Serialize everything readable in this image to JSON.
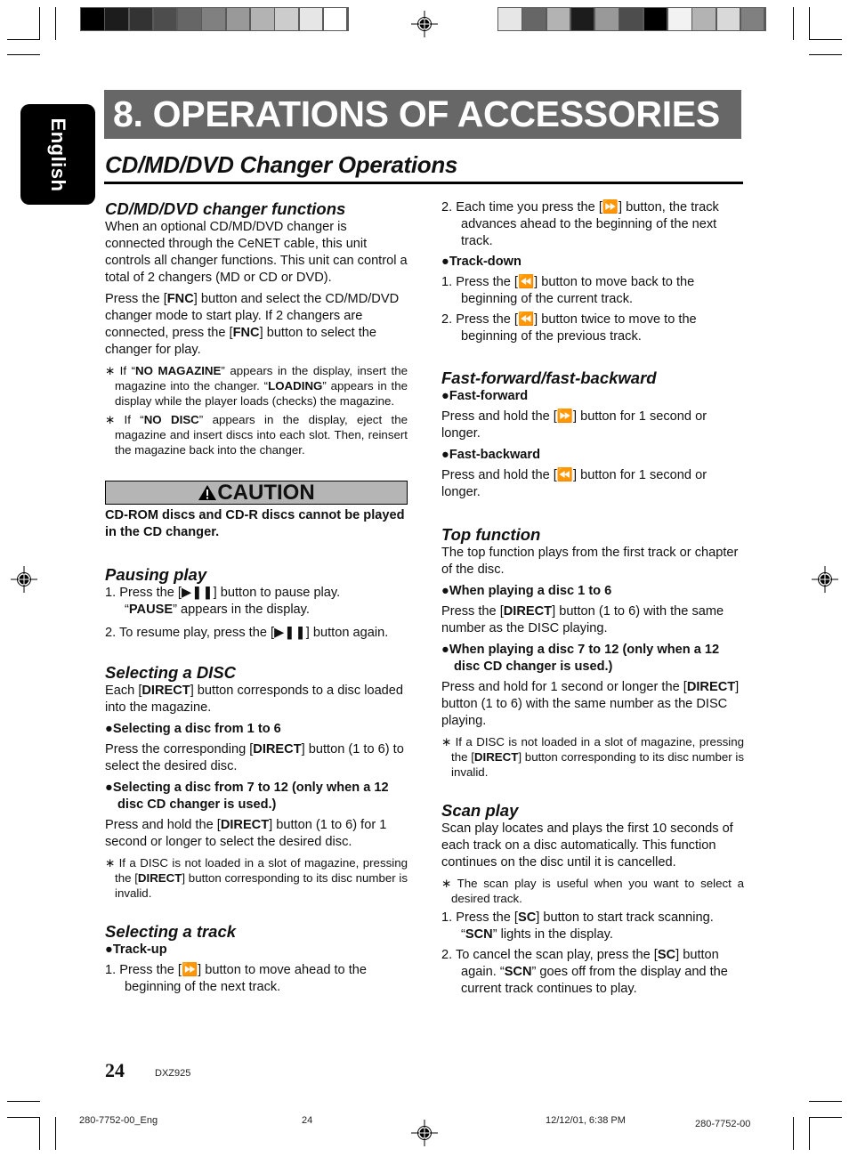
{
  "language_tab": "English",
  "chapter_title": "8. OPERATIONS OF ACCESSORIES",
  "section_title": "CD/MD/DVD Changer Operations",
  "colors": {
    "banner_bg": "#676767",
    "caution_bg": "#b5b5b5",
    "swatches_left": [
      "#000000",
      "#1c1c1c",
      "#333333",
      "#4d4d4d",
      "#666666",
      "#808080",
      "#999999",
      "#b3b3b3",
      "#cccccc",
      "#e6e6e6",
      "#ffffff"
    ],
    "swatches_right": [
      "#e6e6e6",
      "#666666",
      "#b3b3b3",
      "#1c1c1c",
      "#999999",
      "#4d4d4d",
      "#000000",
      "#f2f2f2",
      "#b3b3b3",
      "#d9d9d9",
      "#808080"
    ]
  },
  "left": {
    "changer_functions": {
      "heading": "CD/MD/DVD changer functions",
      "p1": "When an optional CD/MD/DVD changer is connected through the CeNET cable, this unit controls all changer functions. This unit can control a total of 2 changers (MD or CD or DVD).",
      "p2_a": "Press the [",
      "p2_b1": "FNC",
      "p2_c": "] button and select the CD/MD/DVD changer mode to start play. If 2 changers are connected, press the [",
      "p2_b2": "FNC",
      "p2_d": "] button to select the changer for play.",
      "note1_a": "∗ If “",
      "note1_b": "NO MAGAZINE",
      "note1_c": "” appears in the display, insert the magazine into the changer. “",
      "note1_d": "LOADING",
      "note1_e": "” appears in the display while the player loads (checks) the magazine.",
      "note2_a": "∗ If “",
      "note2_b": "NO DISC",
      "note2_c": "” appears in the display, eject the magazine and insert discs into each slot. Then, reinsert the magazine back into the changer."
    },
    "caution": {
      "label": "CAUTION",
      "text": "CD-ROM discs and CD-R discs cannot be played in the CD changer."
    },
    "pausing": {
      "heading": "Pausing play",
      "step1_a": "1.  Press the [▶❚❚] button to pause play.",
      "step1_b": "PAUSE",
      "step1_c": "” appears in the display.",
      "step2": "2.  To resume play, press the [▶❚❚] button again."
    },
    "selecting_disc": {
      "heading": "Selecting a DISC",
      "p1_a": "Each [",
      "p1_b": "DIRECT",
      "p1_c": "] button corresponds to a disc loaded into the magazine.",
      "bullet1": "●Selecting a disc from 1 to 6",
      "p2_a": "Press the corresponding [",
      "p2_b": "DIRECT",
      "p2_c": "] button (1 to 6) to select the desired disc.",
      "bullet2": "●Selecting a disc from 7 to 12 (only when a 12 disc CD changer is used.)",
      "p3_a": "Press and hold the [",
      "p3_b": "DIRECT",
      "p3_c": "] button (1 to 6) for 1 second or longer to select the desired disc.",
      "note_a": "∗ If a DISC is not loaded in a slot of magazine, pressing  the [",
      "note_b": "DIRECT",
      "note_c": "] button corresponding to its disc number is invalid."
    },
    "selecting_track": {
      "heading": "Selecting a track",
      "bullet": "●Track-up",
      "step1": "1.  Press the [⏩] button to move ahead to the beginning of the next track."
    }
  },
  "right": {
    "track_up_step2": "2.  Each time you press the [⏩] button, the track advances ahead to the beginning of the next track.",
    "track_down": {
      "bullet": "●Track-down",
      "step1": "1.  Press the [⏪] button to move back to the beginning of the current track.",
      "step2": "2.  Press the [⏪] button twice to move to the beginning of the previous track."
    },
    "fast": {
      "heading": "Fast-forward/fast-backward",
      "bullet1": "●Fast-forward",
      "p1": "Press and hold the [⏩] button for 1 second or longer.",
      "bullet2": "●Fast-backward",
      "p2": "Press and hold the [⏪] button for 1 second or longer."
    },
    "top": {
      "heading": "Top function",
      "p1": "The top function plays from the first track or chapter of the disc.",
      "bullet1": "●When playing a disc 1 to 6",
      "p2_a": "Press the [",
      "p2_b": "DIRECT",
      "p2_c": "] button (1 to 6) with the same number as the DISC playing.",
      "bullet2": "●When playing a disc 7 to 12 (only when a 12 disc CD changer is used.)",
      "p3_a": "Press and hold for 1 second or longer the [",
      "p3_b": "DIRECT",
      "p3_c": "] button (1 to 6) with the same number as the DISC playing.",
      "note_a": "∗ If a DISC is not loaded in a slot of magazine, pressing  the [",
      "note_b": "DIRECT",
      "note_c": "] button corresponding to its disc number is invalid."
    },
    "scan": {
      "heading": "Scan play",
      "p1": "Scan play locates and plays the first 10 seconds of each track on a disc automatically. This function continues on the disc until it is cancelled.",
      "note": "∗ The scan play is useful when you want to select a desired track.",
      "step1_a": "1.  Press the [",
      "step1_b": "SC",
      "step1_c": "] button to start track scanning. “",
      "step1_d": "SCN",
      "step1_e": "” lights in the display.",
      "step2_a": "2.  To cancel the scan play, press the [",
      "step2_b": "SC",
      "step2_c": "] button again. “",
      "step2_d": "SCN",
      "step2_e": "” goes off from the display and the current track continues to play."
    }
  },
  "footer": {
    "page_number": "24",
    "model": "DXZ925",
    "file_name": "280-7752-00_Eng",
    "sheet_number": "24",
    "timestamp": "12/12/01, 6:38 PM",
    "part_number": "280-7752-00"
  }
}
